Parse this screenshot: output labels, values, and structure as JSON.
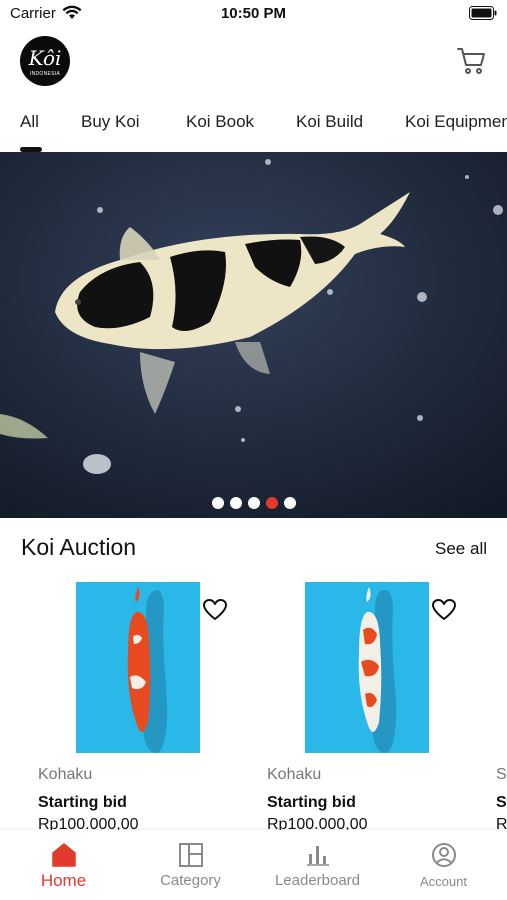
{
  "status_bar": {
    "carrier": "Carrier",
    "time": "10:50 PM"
  },
  "header": {
    "logo_main": "Kôi",
    "logo_sub": "INDONESIA",
    "cart_icon": "cart-icon"
  },
  "tabs": [
    {
      "label": "All"
    },
    {
      "label": "Buy Koi"
    },
    {
      "label": "Koi Book"
    },
    {
      "label": "Koi Build"
    },
    {
      "label": "Koi Equipment"
    }
  ],
  "banner": {
    "slides": 5,
    "active_slide": 4
  },
  "section": {
    "title": "Koi Auction",
    "see_all": "See all"
  },
  "cards": [
    {
      "variety": "Kohaku",
      "bid_label": "Starting bid",
      "price": "Rp100.000,00"
    },
    {
      "variety": "Kohaku",
      "bid_label": "Starting bid",
      "price": "Rp100.000,00"
    },
    {
      "variety": "Sa",
      "bid_label": "St",
      "price": "R"
    }
  ],
  "bottom_nav": [
    {
      "label": "Home",
      "icon": "home-icon",
      "active": true
    },
    {
      "label": "Category",
      "icon": "category-icon",
      "active": false
    },
    {
      "label": "Leaderboard",
      "icon": "leaderboard-icon",
      "active": false
    },
    {
      "label": "Account",
      "icon": "account-icon",
      "active": false
    }
  ],
  "colors": {
    "accent": "#e23a2e",
    "water": "#2ab8e8",
    "banner_bg": "#1f2838"
  }
}
